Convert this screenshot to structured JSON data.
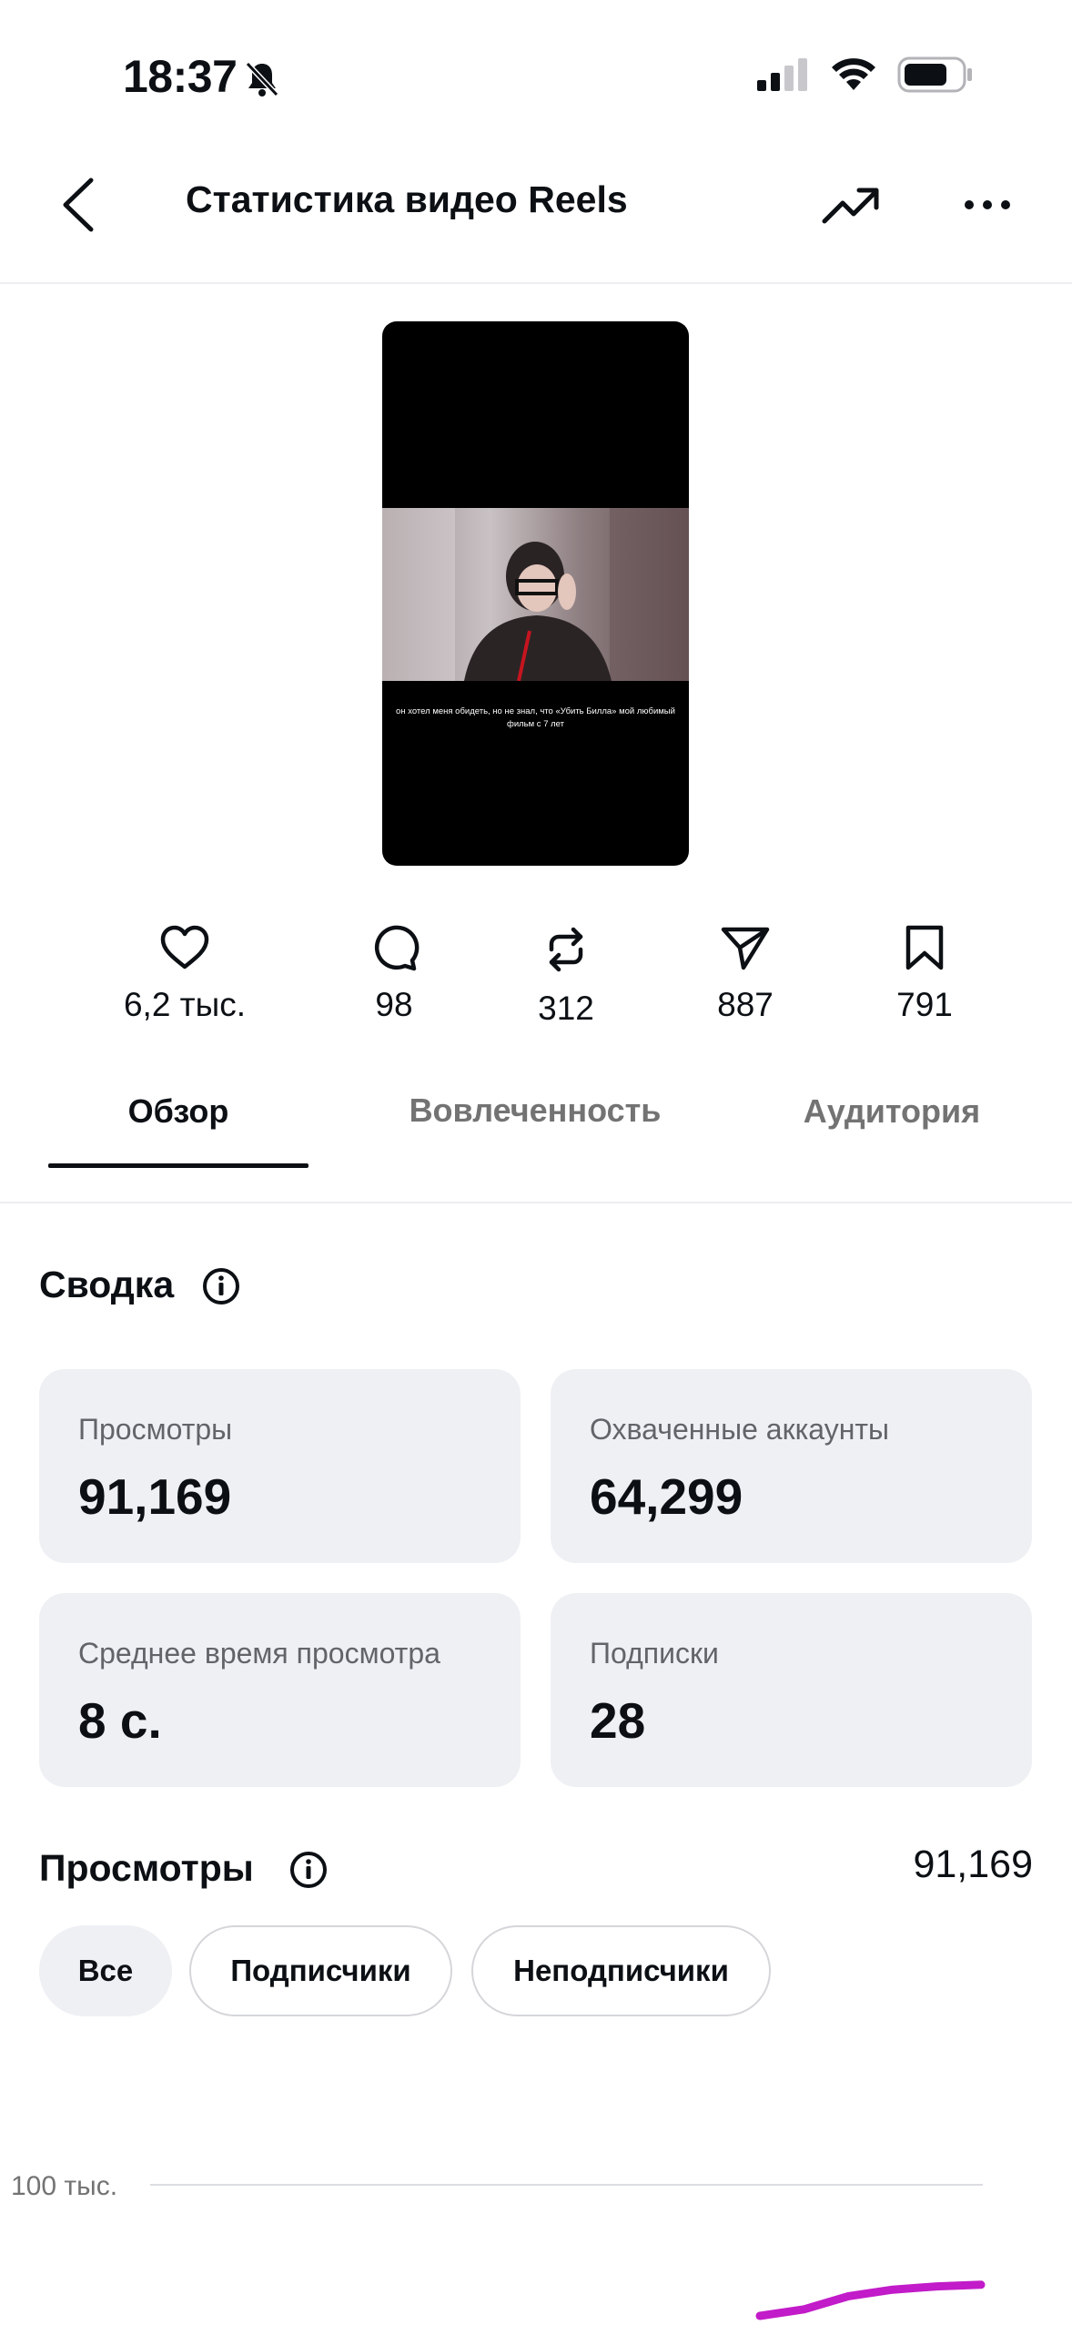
{
  "status_bar": {
    "time": "18:37"
  },
  "header": {
    "title": "Статистика видео Reels"
  },
  "thumbnail": {
    "caption": "он хотел меня обидеть, но не знал, что «Убить Билла» мой любимый фильм с 7 лет"
  },
  "stats": {
    "likes": "6,2 тыс.",
    "comments": "98",
    "reposts": "312",
    "shares": "887",
    "saves": "791"
  },
  "tabs": [
    {
      "label": "Обзор",
      "active": true
    },
    {
      "label": "Вовлеченность",
      "active": false
    },
    {
      "label": "Аудитория",
      "active": false
    }
  ],
  "summary": {
    "title": "Сводка",
    "cards": [
      {
        "label": "Просмотры",
        "value": "91,169"
      },
      {
        "label": "Охваченные аккаунты",
        "value": "64,299"
      },
      {
        "label": "Среднее время просмотра",
        "value": "8 с."
      },
      {
        "label": "Подписки",
        "value": "28"
      }
    ]
  },
  "views_section": {
    "title": "Просмотры",
    "total": "91,169",
    "filters": [
      "Все",
      "Подписчики",
      "Неподписчики"
    ],
    "active_filter": "Все"
  },
  "chart_data": {
    "type": "line",
    "y_tick_labels": [
      "100 тыс."
    ],
    "series": [
      {
        "color": "#c21bc9",
        "values": [
          60000,
          62000,
          66000,
          68000,
          69000,
          69500
        ]
      }
    ],
    "ylim": [
      0,
      100000
    ]
  },
  "colors": {
    "text": "#0c1014",
    "muted": "#737373",
    "card_bg": "#eff0f4",
    "chart_line": "#c21bc9"
  }
}
